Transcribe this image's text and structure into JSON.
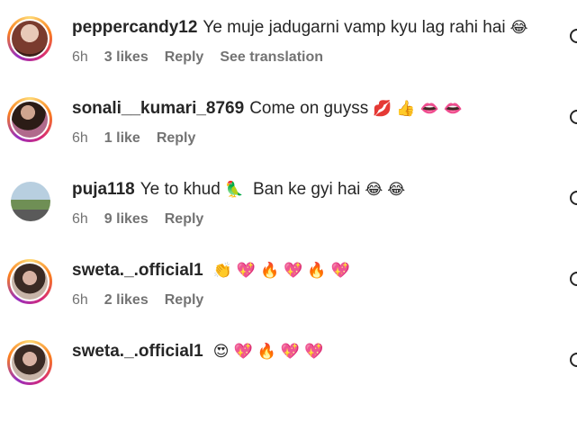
{
  "comments": [
    {
      "username": "peppercandy12",
      "text": "Ye muje jadugarni vamp kyu lag rahi hai",
      "emojis": [
        "😂"
      ],
      "time": "6h",
      "likes": "3 likes",
      "reply": "Reply",
      "translate": "See translation",
      "avatar_colors": [
        "#c9a79a",
        "#7a3b2e"
      ]
    },
    {
      "username": "sonali__kumari_8769",
      "text": "Come on guyss",
      "emojis": [
        "💋",
        "👍",
        "👄",
        "👄"
      ],
      "time": "6h",
      "likes": "1 like",
      "reply": "Reply",
      "avatar_colors": [
        "#a08070",
        "#2b1c16"
      ]
    },
    {
      "username": "puja118",
      "text": "Ye to khud",
      "text2": "Ban ke gyi hai",
      "emojis": [
        "🦜"
      ],
      "emojis2": [
        "😂",
        "😂"
      ],
      "time": "6h",
      "likes": "9 likes",
      "reply": "Reply",
      "avatar_colors": [
        "#9fb7c9",
        "#4f6b3a"
      ]
    },
    {
      "username": "sweta._.official1",
      "text": "",
      "emojis": [
        "👏",
        "💖",
        "🔥",
        "💖",
        "🔥",
        "💖"
      ],
      "time": "6h",
      "likes": "2 likes",
      "reply": "Reply",
      "avatar_colors": [
        "#c7b4a8",
        "#3a2a24"
      ]
    },
    {
      "username": "sweta._.official1",
      "text": "",
      "emojis": [
        "😍",
        "💖",
        "🔥",
        "💖",
        "💖"
      ],
      "avatar_colors": [
        "#c7b4a8",
        "#3a2a24"
      ]
    }
  ]
}
